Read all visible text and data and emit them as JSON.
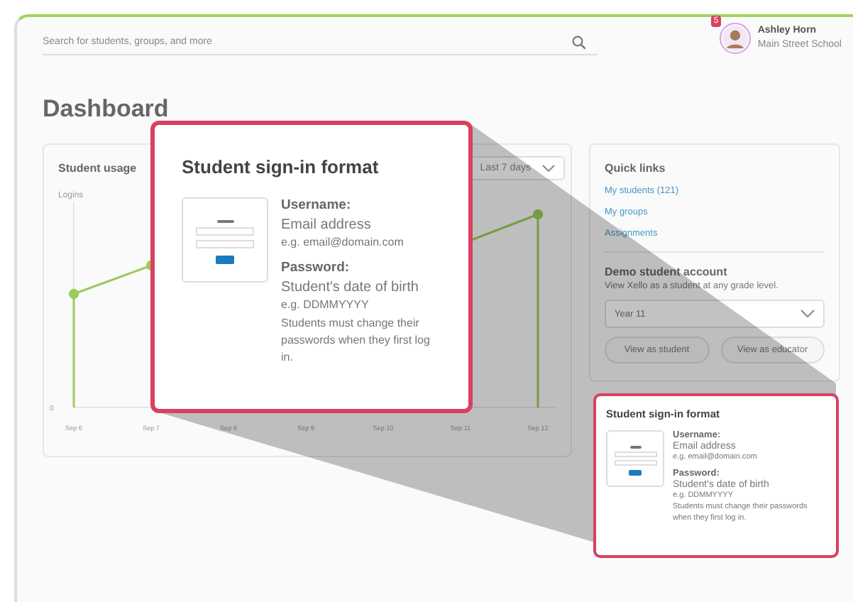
{
  "search": {
    "placeholder": "Search for students, groups, and more"
  },
  "user": {
    "name": "Ashley Horn",
    "school": "Main Street School",
    "badge": "5"
  },
  "page_title": "Dashboard",
  "usage": {
    "title": "Student usage",
    "range": "Last 7 days",
    "y_label": "Logins",
    "y_tick": "0",
    "x_labels": [
      "Sep 6",
      "Sep 7",
      "Sep 8",
      "Sep 9",
      "Sep 10",
      "Sep 11",
      "Sep 12"
    ]
  },
  "quick_links": {
    "title": "Quick links",
    "links": [
      "My students (121)",
      "My groups",
      "Assignments"
    ]
  },
  "demo": {
    "title": "Demo student account",
    "subtitle": "View Xello as a student at any grade level.",
    "grade": "Year 11",
    "buttons": [
      "View as student",
      "View as educator"
    ]
  },
  "sign_in_card": {
    "title": "Student sign-in format",
    "username_label": "Username:",
    "username_value": "Email address",
    "username_example": "e.g. email@domain.com",
    "password_label": "Password:",
    "password_value": "Student's date of birth",
    "password_example": "e.g. DDMMYYYY",
    "note": "Students must change their passwords when they first log in."
  },
  "callout": {
    "title": "Student sign-in format",
    "username_label": "Username:",
    "username_value": "Email address",
    "username_example": "e.g. email@domain.com",
    "password_label": "Password:",
    "password_value": "Student's date of birth",
    "password_example": "e.g. DDMMYYYY",
    "note": "Students must change their passwords when they first log in."
  }
}
